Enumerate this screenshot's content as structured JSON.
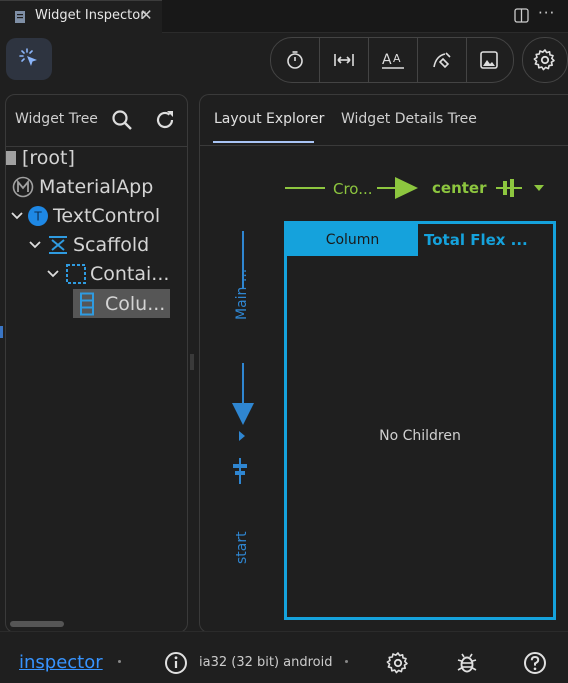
{
  "tab": {
    "title": "Widget Inspector",
    "close": "✕",
    "more": "···"
  },
  "toolbar": {
    "select_mode_icon": "select-widget-icon",
    "tools": [
      "timer-icon",
      "width-icon",
      "font-icon",
      "repaint-icon",
      "image-icon"
    ],
    "settings_icon": "gear-icon"
  },
  "widget_tree": {
    "title": "Widget Tree",
    "nodes": [
      {
        "label": "[root]",
        "icon": "root-square-icon",
        "depth": 0,
        "expandable": false
      },
      {
        "label": "MaterialApp",
        "icon": "material-m-icon",
        "depth": 0,
        "expandable": false
      },
      {
        "label": "TextControl",
        "icon": "t-circle-icon",
        "depth": 0,
        "expandable": true
      },
      {
        "label": "Scaffold",
        "icon": "scaffold-icon",
        "depth": 1,
        "expandable": true
      },
      {
        "label": "Contai...",
        "icon": "container-icon",
        "depth": 2,
        "expandable": true
      },
      {
        "label": "Colu...",
        "icon": "column-icon",
        "depth": 3,
        "expandable": false,
        "selected": true
      }
    ]
  },
  "layout": {
    "tabs": [
      "Layout Explorer",
      "Widget Details Tree"
    ],
    "active_tab": 0,
    "cross_axis": {
      "label": "Cro...",
      "value": "center"
    },
    "main_axis": {
      "label": "Main ...",
      "value": "start"
    },
    "widget_tag": "Column",
    "total_flex": "Total Flex ...",
    "empty": "No Children"
  },
  "status": {
    "link": "inspector",
    "platform": "ia32 (32 bit) android",
    "icons": [
      "info-icon",
      "gear-icon",
      "bug-icon",
      "help-icon"
    ]
  },
  "colors": {
    "accent_blue": "#15a2dc",
    "cross_axis_green": "#8dc63f",
    "main_axis_blue": "#2f86d1",
    "link_blue": "#3794ff"
  }
}
